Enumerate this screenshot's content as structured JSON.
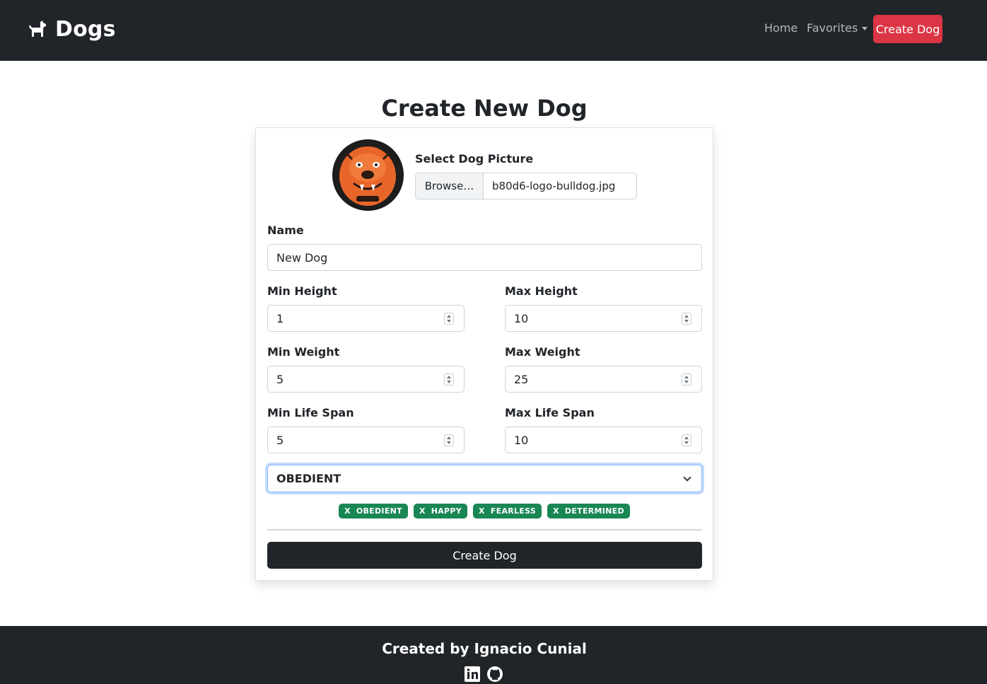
{
  "navbar": {
    "brand": "Dogs",
    "home": "Home",
    "favorites": "Favorites",
    "create": "Create Dog"
  },
  "page": {
    "title": "Create New Dog"
  },
  "form": {
    "picture_label": "Select Dog Picture",
    "browse": "Browse…",
    "file_name": "b80d6-logo-bulldog.jpg",
    "name_label": "Name",
    "name_value": "New Dog",
    "min_height_label": "Min Height",
    "min_height": "1",
    "max_height_label": "Max Height",
    "max_height": "10",
    "min_weight_label": "Min Weight",
    "min_weight": "5",
    "max_weight_label": "Max Weight",
    "max_weight": "25",
    "min_life_label": "Min Life Span",
    "min_life": "5",
    "max_life_label": "Max Life Span",
    "max_life": "10",
    "temperament_selected": "OBEDIENT",
    "badges": [
      {
        "remove": "X",
        "label": "OBEDIENT"
      },
      {
        "remove": "X",
        "label": "HAPPY"
      },
      {
        "remove": "X",
        "label": "FEARLESS"
      },
      {
        "remove": "X",
        "label": "DETERMINED"
      }
    ],
    "submit": "Create Dog"
  },
  "footer": {
    "text": "Created by Ignacio Cunial"
  },
  "colors": {
    "navbar": "#212529",
    "danger": "#dc3545",
    "success": "#198754",
    "focus": "#86b7fe"
  },
  "icons": [
    "dog-icon",
    "caret-down-icon",
    "linkedin-icon",
    "github-icon",
    "chevron-down-icon",
    "spinner-icon"
  ]
}
